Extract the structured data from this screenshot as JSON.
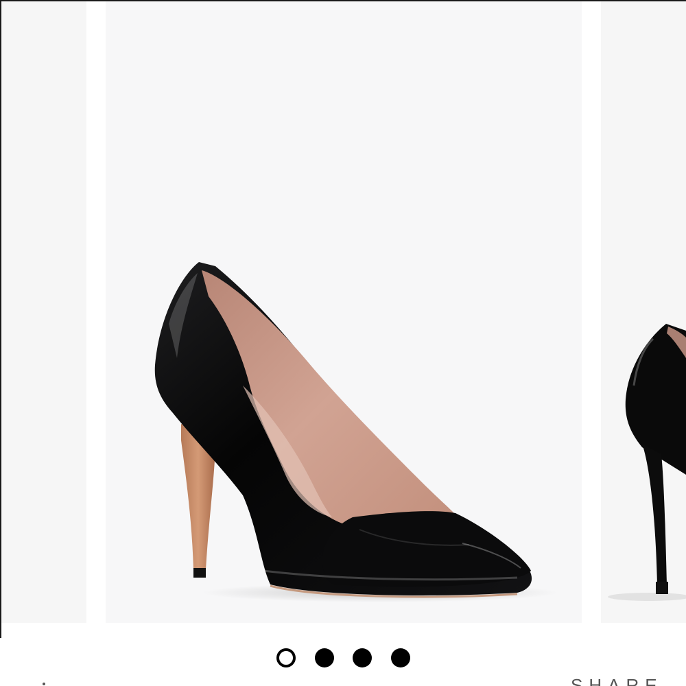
{
  "carousel": {
    "slide_count": 4,
    "active_index": 0,
    "dots": [
      {
        "state": "active"
      },
      {
        "state": "inactive"
      },
      {
        "state": "inactive"
      },
      {
        "state": "inactive"
      }
    ]
  },
  "product_image": {
    "icon": "black-patent-pump-shoe-image",
    "colors": {
      "background": "#f7f7f8",
      "patent": "#000000",
      "lining": "#c79a88",
      "heel": "#c98f6c"
    }
  },
  "share": {
    "label": "SHARE"
  }
}
